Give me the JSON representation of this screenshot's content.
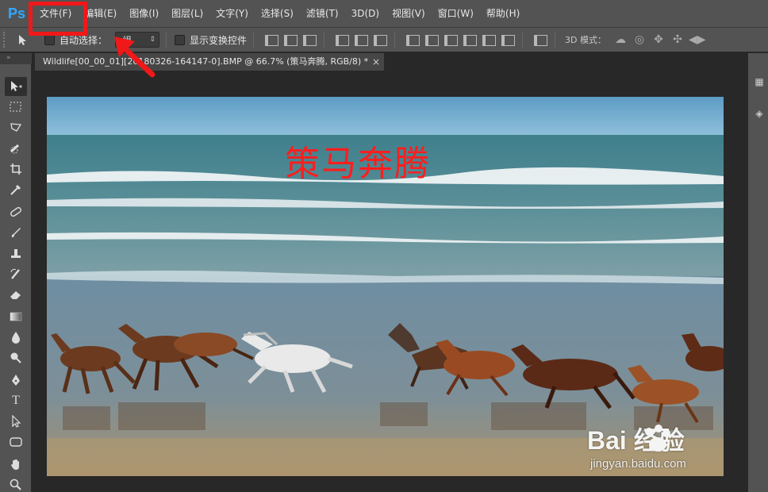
{
  "app": {
    "logo": "Ps"
  },
  "menu": [
    "文件(F)",
    "编辑(E)",
    "图像(I)",
    "图层(L)",
    "文字(Y)",
    "选择(S)",
    "滤镜(T)",
    "3D(D)",
    "视图(V)",
    "窗口(W)",
    "帮助(H)"
  ],
  "options": {
    "auto_select_label": "自动选择：",
    "auto_select_value": "组",
    "show_transform_label": "显示变换控件",
    "mode_3d_label": "3D 模式："
  },
  "document": {
    "tab_title": "Wildlife[00_00_01][20180326-164147-0].BMP @ 66.7% (策马奔腾, RGB/8) *",
    "close_glyph": "×"
  },
  "canvas": {
    "text_layer": "策马奔腾"
  },
  "watermark": {
    "brand": "Bai  经验",
    "url": "jingyan.baidu.com"
  },
  "colors": {
    "annotation": "#f01818",
    "canvas_text": "#ff1e1e",
    "ui_bg": "#535353"
  },
  "icons": {
    "move": "move-tool-icon",
    "marquee": "marquee-icon",
    "lasso": "lasso-icon",
    "quick_select": "quick-select-icon",
    "crop": "crop-icon",
    "eyedropper": "eyedropper-icon",
    "healing": "healing-brush-icon",
    "brush": "brush-icon",
    "stamp": "clone-stamp-icon",
    "history_brush": "history-brush-icon",
    "eraser": "eraser-icon",
    "gradient": "gradient-icon",
    "blur": "blur-icon",
    "dodge": "dodge-icon",
    "pen": "pen-icon",
    "type": "type-icon",
    "path_select": "path-selection-icon",
    "shape": "shape-icon",
    "hand": "hand-icon",
    "zoom": "zoom-icon"
  }
}
